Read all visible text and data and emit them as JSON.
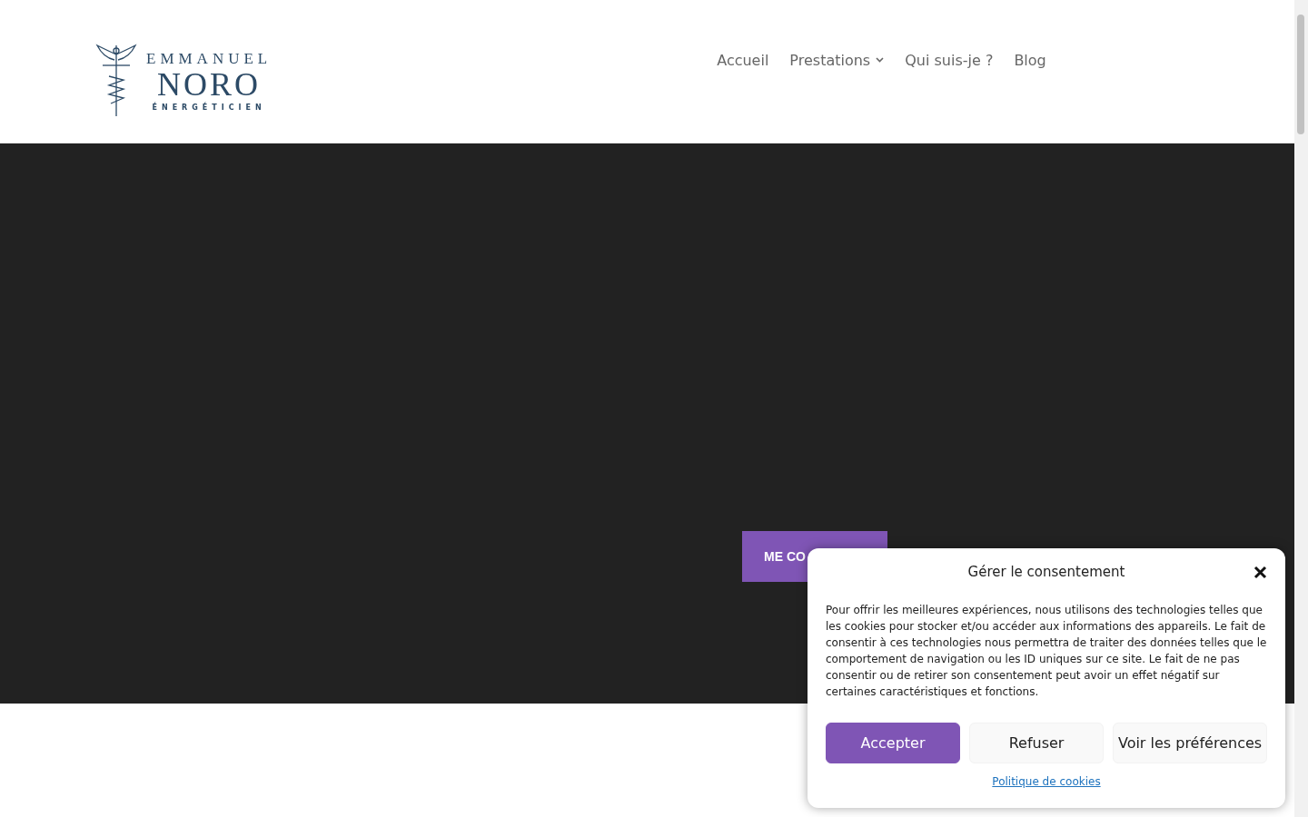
{
  "logo": {
    "name_top": "EMMANUEL",
    "name_main": "NORO",
    "subtitle": "ÉNERGÉTICIEN"
  },
  "nav": [
    {
      "label": "Accueil",
      "dropdown": false
    },
    {
      "label": "Prestations",
      "dropdown": true
    },
    {
      "label": "Qui suis-je ?",
      "dropdown": false
    },
    {
      "label": "Blog",
      "dropdown": false
    }
  ],
  "hero": {
    "button": "ME CO"
  },
  "consent": {
    "title": "Gérer le consentement",
    "text": "Pour offrir les meilleures expériences, nous utilisons des technologies telles que les cookies pour stocker et/ou accéder aux informations des appareils. Le fait de consentir à ces technologies nous permettra de traiter des données telles que le comportement de navigation ou les ID uniques sur ce site. Le fait de ne pas consentir ou de retirer son consentement peut avoir un effet négatif sur certaines caractéristiques et fonctions.",
    "buttons": [
      {
        "label": "Accepter",
        "kind": "primary"
      },
      {
        "label": "Refuser",
        "kind": "secondary"
      },
      {
        "label": "Voir les préférences",
        "kind": "secondary"
      }
    ],
    "link": "Politique de cookies"
  }
}
